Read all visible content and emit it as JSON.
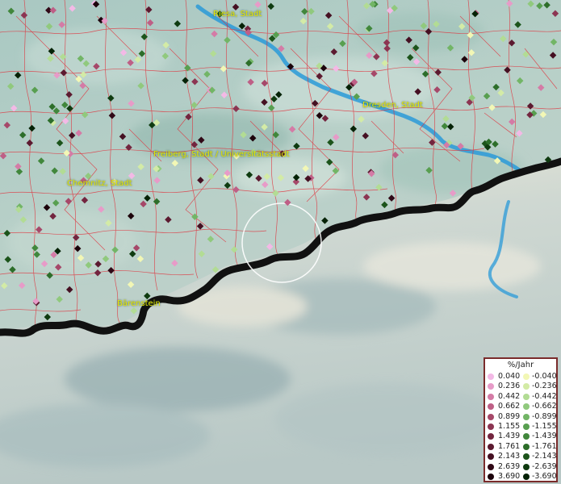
{
  "map": {
    "cities": [
      {
        "id": "riesa",
        "name": "Riesa, Stadt"
      },
      {
        "id": "dresden",
        "name": "Dresden, Stadt"
      },
      {
        "id": "freiberg",
        "name": "Freiberg, Stadt / Universitätsstadt"
      },
      {
        "id": "chemnitz",
        "name": "Chemnitz, Stadt"
      },
      {
        "id": "baerenstein",
        "name": "Bärenstein"
      }
    ],
    "colors": {
      "terrain_lowland": "#a9c8c2",
      "terrain_mountain": "#dfe3e0",
      "border": "#111111",
      "district_lines": "#e0303a",
      "river": "#2a9ad8",
      "city_label": "#e6e600",
      "highlight_circle": "#ffffff"
    }
  },
  "legend": {
    "title": "%/Jahr",
    "positive": [
      {
        "label": "0.040",
        "color": "#f3b9e6"
      },
      {
        "label": "0.236",
        "color": "#e79bc8"
      },
      {
        "label": "0.442",
        "color": "#d47ba6"
      },
      {
        "label": "0.662",
        "color": "#be5f86"
      },
      {
        "label": "0.899",
        "color": "#a64869"
      },
      {
        "label": "1.155",
        "color": "#8c3552"
      },
      {
        "label": "1.439",
        "color": "#73253f"
      },
      {
        "label": "1.761",
        "color": "#5c1a30"
      },
      {
        "label": "2.143",
        "color": "#451022"
      },
      {
        "label": "2.639",
        "color": "#300816"
      },
      {
        "label": "3.690",
        "color": "#1c030b"
      }
    ],
    "negative": [
      {
        "label": "-0.040",
        "color": "#f2f7b5"
      },
      {
        "label": "-0.236",
        "color": "#d3eba6"
      },
      {
        "label": "-0.442",
        "color": "#b2dc94"
      },
      {
        "label": "-0.662",
        "color": "#90c97d"
      },
      {
        "label": "-0.899",
        "color": "#72b566"
      },
      {
        "label": "-1.155",
        "color": "#589f50"
      },
      {
        "label": "-1.439",
        "color": "#41873c"
      },
      {
        "label": "-1.761",
        "color": "#2d6e2a"
      },
      {
        "label": "-2.143",
        "color": "#1c541b"
      },
      {
        "label": "-2.639",
        "color": "#0f3b10"
      },
      {
        "label": "-3.690",
        "color": "#052206"
      }
    ]
  }
}
